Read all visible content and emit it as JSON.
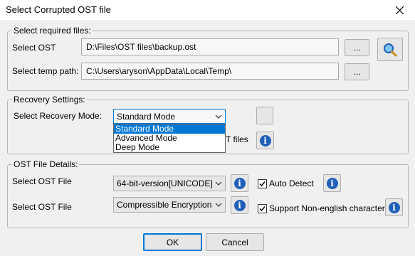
{
  "window": {
    "title": "Select Corrupted OST file"
  },
  "required_files": {
    "group_label": "Select required files:",
    "ost_label": "Select OST",
    "ost_value": "D:\\Files\\OST files\\backup.ost",
    "browse_label": "...",
    "temp_label": "Select temp path:",
    "temp_value": "C:\\Users\\aryson\\AppData\\Local\\Temp\\",
    "browse2_label": "..."
  },
  "recovery": {
    "group_label": "Recovery Settings:",
    "mode_label": "Select Recovery Mode:",
    "mode_selected": "Standard Mode",
    "mode_options": [
      "Standard Mode",
      "Advanced Mode",
      "Deep Mode"
    ],
    "partial_text": "T files"
  },
  "ost_details": {
    "group_label": "OST File Details:",
    "version_label": "Select OST File",
    "version_value": "64-bit-version[UNICODE]",
    "encryption_label": "Select OST File",
    "encryption_value": "Compressible Encryption",
    "auto_detect_label": "Auto Detect",
    "auto_detect_checked": true,
    "non_english_label": "Support Non-english characters",
    "non_english_checked": true
  },
  "footer": {
    "ok_label": "OK",
    "cancel_label": "Cancel"
  },
  "colors": {
    "accent": "#0078d7",
    "info_icon": "#1f5fb8"
  }
}
